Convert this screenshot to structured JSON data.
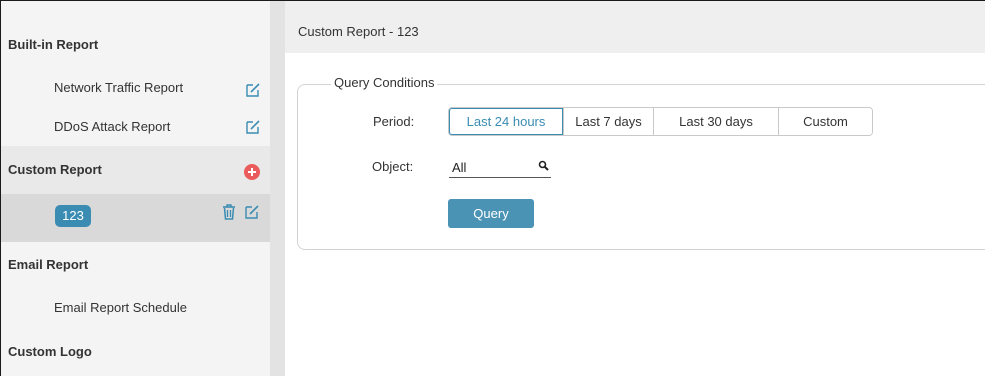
{
  "sidebar": {
    "builtin_title": "Built-in Report",
    "builtin_items": [
      {
        "label": "Network Traffic Report",
        "icon": "edit-icon"
      },
      {
        "label": "DDoS Attack Report",
        "icon": "edit-icon"
      }
    ],
    "custom_title": "Custom Report",
    "custom_add_icon": "add-icon",
    "custom_reports": [
      {
        "label": "123",
        "icons": [
          "trash-icon",
          "edit-icon"
        ]
      }
    ],
    "email_title": "Email Report",
    "email_items": [
      {
        "label": "Email Report Schedule"
      }
    ],
    "logo_title": "Custom Logo"
  },
  "main": {
    "title": "Custom Report - 123",
    "conditions": {
      "legend": "Query Conditions",
      "period_label": "Period:",
      "period_options": [
        "Last 24 hours",
        "Last 7 days",
        "Last 30 days",
        "Custom"
      ],
      "period_selected": "Last 24 hours",
      "object_label": "Object:",
      "object_value": "All",
      "query_button": "Query"
    }
  },
  "colors": {
    "accent": "#3a8cb3",
    "add": "#ea5b5b",
    "sidebar_bg": "#f4f4f4",
    "selected_bg": "#d9d9d9"
  }
}
